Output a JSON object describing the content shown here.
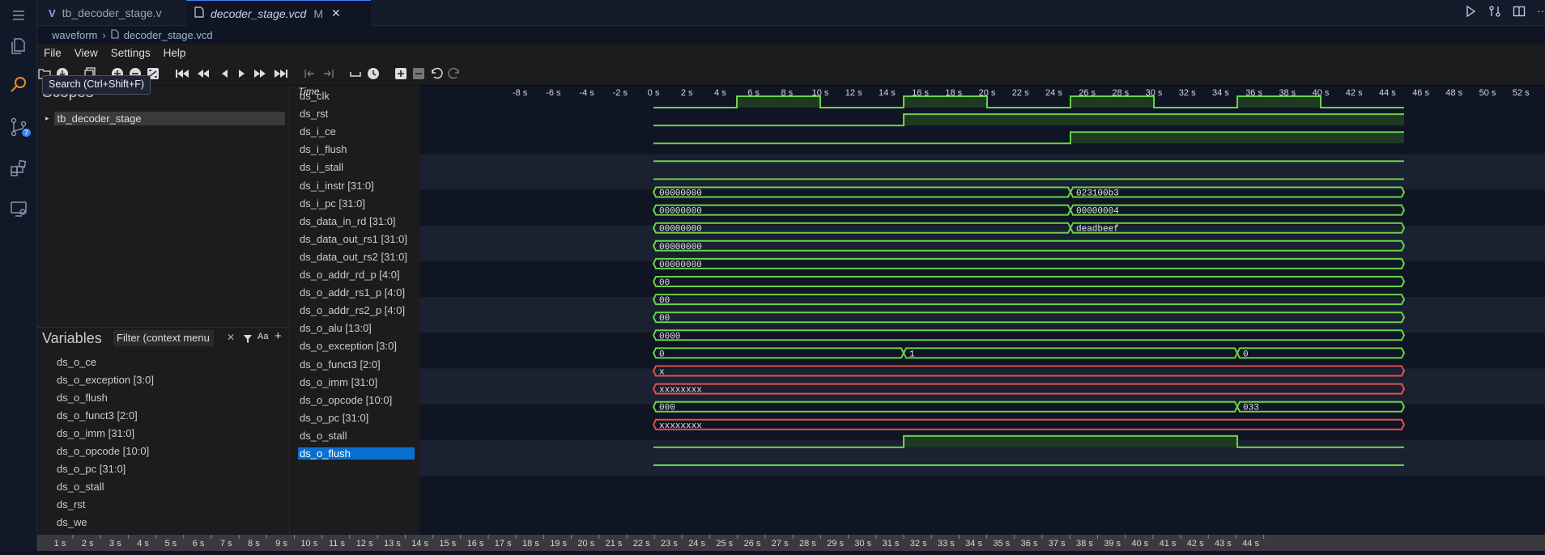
{
  "tabs": [
    {
      "label": "tb_decoder_stage.v",
      "active": false
    },
    {
      "label": "decoder_stage.vcd",
      "active": true,
      "badge": "M"
    }
  ],
  "breadcrumb": {
    "root": "waveform",
    "file": "decoder_stage.vcd"
  },
  "menu": [
    "File",
    "View",
    "Settings",
    "Help"
  ],
  "tooltip": "Search (Ctrl+Shift+F)",
  "scm_badge": "7",
  "scopes": {
    "title": "Scopes",
    "root": "tb_decoder_stage"
  },
  "variables": {
    "title": "Variables",
    "filter_placeholder": "Filter (context menu",
    "items": [
      "ds_o_ce",
      "ds_o_exception [3:0]",
      "ds_o_flush",
      "ds_o_funct3 [2:0]",
      "ds_o_imm [31:0]",
      "ds_o_opcode [10:0]",
      "ds_o_pc [31:0]",
      "ds_o_stall",
      "ds_rst",
      "ds_we"
    ]
  },
  "time_label": "Time",
  "time_ticks": [
    "-8 s",
    "-6 s",
    "-4 s",
    "-2 s",
    "0 s",
    "2 s",
    "4 s",
    "6 s",
    "8 s",
    "10 s",
    "12 s",
    "14 s",
    "16 s",
    "18 s",
    "20 s",
    "22 s",
    "24 s",
    "26 s",
    "28 s",
    "30 s",
    "32 s",
    "34 s",
    "36 s",
    "38 s",
    "40 s",
    "42 s",
    "44 s",
    "46 s",
    "48 s",
    "50 s",
    "52 s"
  ],
  "bottom_ticks": [
    "1 s",
    "2 s",
    "3 s",
    "4 s",
    "5 s",
    "6 s",
    "7 s",
    "8 s",
    "9 s",
    "10 s",
    "11 s",
    "12 s",
    "13 s",
    "14 s",
    "15 s",
    "16 s",
    "17 s",
    "18 s",
    "19 s",
    "20 s",
    "21 s",
    "22 s",
    "23 s",
    "24 s",
    "25 s",
    "26 s",
    "27 s",
    "28 s",
    "29 s",
    "30 s",
    "31 s",
    "32 s",
    "33 s",
    "34 s",
    "35 s",
    "36 s",
    "37 s",
    "38 s",
    "39 s",
    "40 s",
    "41 s",
    "42 s",
    "43 s",
    "44 s"
  ],
  "colors": {
    "wave": "#6ad24a",
    "wave_fill": "#1f3a22",
    "undef": "#e0524f",
    "select": "#0a6fd1"
  },
  "signals": [
    {
      "name": "ds_clk",
      "kind": "bit",
      "edges": [
        [
          0,
          0
        ],
        [
          10,
          1
        ],
        [
          20,
          0
        ],
        [
          30,
          1
        ],
        [
          40,
          0
        ],
        [
          50,
          1
        ],
        [
          60,
          0
        ],
        [
          70,
          1
        ],
        [
          80,
          0
        ],
        [
          90,
          0
        ]
      ]
    },
    {
      "name": "ds_rst",
      "kind": "bit",
      "edges": [
        [
          0,
          0
        ],
        [
          30,
          1
        ],
        [
          90,
          1
        ]
      ]
    },
    {
      "name": "ds_i_ce",
      "kind": "bit",
      "edges": [
        [
          0,
          0
        ],
        [
          50,
          1
        ],
        [
          90,
          1
        ]
      ]
    },
    {
      "name": "ds_i_flush",
      "kind": "bit",
      "edges": [
        [
          0,
          0
        ],
        [
          90,
          0
        ]
      ]
    },
    {
      "name": "ds_i_stall",
      "kind": "bit",
      "edges": [
        [
          0,
          0
        ],
        [
          90,
          0
        ]
      ]
    },
    {
      "name": "ds_i_instr [31:0]",
      "kind": "bus",
      "segs": [
        [
          0,
          50,
          "00000000"
        ],
        [
          50,
          90,
          "023100b3"
        ]
      ]
    },
    {
      "name": "ds_i_pc [31:0]",
      "kind": "bus",
      "segs": [
        [
          0,
          50,
          "00000000"
        ],
        [
          50,
          90,
          "00000004"
        ]
      ]
    },
    {
      "name": "ds_data_in_rd [31:0]",
      "kind": "bus",
      "segs": [
        [
          0,
          50,
          "00000000"
        ],
        [
          50,
          90,
          "deadbeef"
        ]
      ]
    },
    {
      "name": "ds_data_out_rs1 [31:0]",
      "kind": "bus",
      "segs": [
        [
          0,
          90,
          "00000000"
        ]
      ]
    },
    {
      "name": "ds_data_out_rs2 [31:0]",
      "kind": "bus",
      "segs": [
        [
          0,
          90,
          "00000000"
        ]
      ]
    },
    {
      "name": "ds_o_addr_rd_p [4:0]",
      "kind": "bus",
      "segs": [
        [
          0,
          90,
          "00"
        ]
      ]
    },
    {
      "name": "ds_o_addr_rs1_p [4:0]",
      "kind": "bus",
      "segs": [
        [
          0,
          90,
          "00"
        ]
      ]
    },
    {
      "name": "ds_o_addr_rs2_p [4:0]",
      "kind": "bus",
      "segs": [
        [
          0,
          90,
          "00"
        ]
      ]
    },
    {
      "name": "ds_o_alu [13:0]",
      "kind": "bus",
      "segs": [
        [
          0,
          90,
          "0000"
        ]
      ]
    },
    {
      "name": "ds_o_exception [3:0]",
      "kind": "bus",
      "segs": [
        [
          0,
          30,
          "0"
        ],
        [
          30,
          70,
          "1"
        ],
        [
          70,
          90,
          "0"
        ]
      ]
    },
    {
      "name": "ds_o_funct3 [2:0]",
      "kind": "busx",
      "segs": [
        [
          0,
          90,
          "x"
        ]
      ]
    },
    {
      "name": "ds_o_imm [31:0]",
      "kind": "busx",
      "segs": [
        [
          0,
          90,
          "xxxxxxxx"
        ]
      ]
    },
    {
      "name": "ds_o_opcode [10:0]",
      "kind": "bus",
      "segs": [
        [
          0,
          70,
          "000"
        ],
        [
          70,
          90,
          "033"
        ]
      ]
    },
    {
      "name": "ds_o_pc [31:0]",
      "kind": "busx",
      "segs": [
        [
          0,
          90,
          "xxxxxxxx"
        ]
      ]
    },
    {
      "name": "ds_o_stall",
      "kind": "bit",
      "edges": [
        [
          0,
          0
        ],
        [
          30,
          1
        ],
        [
          70,
          0
        ],
        [
          90,
          0
        ]
      ]
    },
    {
      "name": "ds_o_flush",
      "kind": "bit",
      "selected": true,
      "edges": [
        [
          0,
          0
        ],
        [
          90,
          0
        ]
      ]
    }
  ]
}
